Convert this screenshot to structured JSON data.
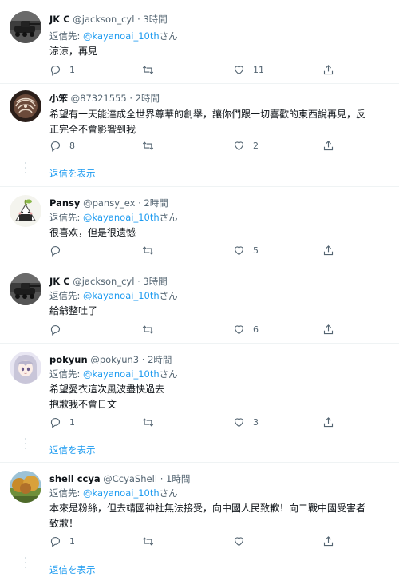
{
  "ui": {
    "reply_prefix": "返信先: ",
    "reply_suffix": "さん",
    "show_replies": "返信を表示",
    "dot": "·"
  },
  "tweets": [
    {
      "name": "JK C",
      "handle": "@jackson_cyl",
      "time": "3時間",
      "reply_to": "@kayanoai_10th",
      "text": [
        "涼涼，再見"
      ],
      "replies": "1",
      "retweets": "",
      "likes": "11",
      "avatar": "tank"
    },
    {
      "name": "小笨",
      "handle": "@87321555",
      "time": "2時間",
      "reply_to": "",
      "text": [
        "希望有一天能達成全世界尊華的創舉，讓你們跟一切喜歡的東西說再見，反",
        "正完全不會影響到我"
      ],
      "replies": "8",
      "retweets": "",
      "likes": "2",
      "avatar": "swirl"
    },
    {
      "name": "Pansy",
      "handle": "@pansy_ex",
      "time": "2時間",
      "reply_to": "@kayanoai_10th",
      "text": [
        "很喜欢，但是很遗憾"
      ],
      "replies": "",
      "retweets": "",
      "likes": "5",
      "avatar": "onigiri"
    },
    {
      "name": "JK C",
      "handle": "@jackson_cyl",
      "time": "3時間",
      "reply_to": "@kayanoai_10th",
      "text": [
        "給爺整吐了"
      ],
      "replies": "",
      "retweets": "",
      "likes": "6",
      "avatar": "tank"
    },
    {
      "name": "pokyun",
      "handle": "@pokyun3",
      "time": "2時間",
      "reply_to": "@kayanoai_10th",
      "text": [
        "希望愛衣這次風波盡快過去",
        "抱歉我不會日文"
      ],
      "replies": "1",
      "retweets": "",
      "likes": "3",
      "avatar": "anime"
    },
    {
      "name": "shell ccya",
      "handle": "@CcyaShell",
      "time": "1時間",
      "reply_to": "@kayanoai_10th",
      "text": [
        "本來是粉絲，但去靖國神社無法接受，向中國人民致歉！向二戰中國受害者",
        "致歉！"
      ],
      "replies": "1",
      "retweets": "",
      "likes": "",
      "avatar": "landscape"
    }
  ],
  "icons": {
    "reply": "reply-icon",
    "retweet": "retweet-icon",
    "like": "heart-icon",
    "share": "share-icon"
  },
  "colors": {
    "link": "#1d9bf0",
    "muted": "#536471",
    "divider": "#eff3f4"
  }
}
